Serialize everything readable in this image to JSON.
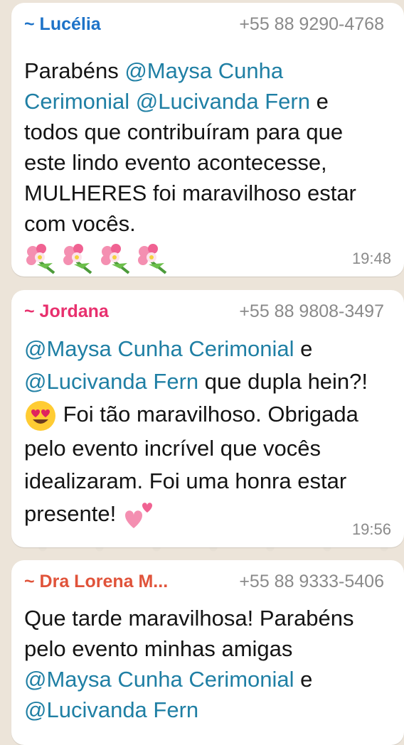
{
  "messages": [
    {
      "sender": "~ Lucélia",
      "sender_color": "#1e73c8",
      "phone": "+55 88 9290-4768",
      "time": "19:48",
      "text": {
        "p1": "Parabéns ",
        "mention1": "@Maysa Cunha Cerimonial",
        "p2": " ",
        "mention2": "@Lucivanda Fern",
        "p3": " e todos que contribuíram para que este lindo evento acontecesse, MULHERES foi maravilhoso estar com vocês."
      },
      "emoji": [
        "bouquet-icon",
        "bouquet-icon",
        "bouquet-icon",
        "bouquet-icon"
      ]
    },
    {
      "sender": "~ Jordana",
      "sender_color": "#e8306e",
      "phone": "+55 88 9808-3497",
      "time": "19:56",
      "text": {
        "mention1": "@Maysa Cunha Cerimonial",
        "p1": " e ",
        "mention2": "@Lucivanda Fern",
        "p2": " que dupla hein?! ",
        "p3": " Foi tão maravilhoso. Obrigada pelo evento incrível que vocês idealizaram. Foi uma honra estar presente! "
      },
      "emoji": [
        "heart-eyes-icon",
        "two-hearts-icon"
      ]
    },
    {
      "sender": "~ Dra Lorena M...",
      "sender_color": "#e0533a",
      "phone": "+55 88 9333-5406",
      "text": {
        "p1": "Que tarde maravilhosa! Parabéns pelo evento minhas amigas ",
        "mention1": "@Maysa Cunha Cerimonial",
        "p2": " e ",
        "mention2": "@Lucivanda Fern"
      }
    }
  ],
  "colors": {
    "mention": "#1f7fa4",
    "background": "#ece4d9",
    "bubble": "#ffffff",
    "meta": "#8a8a8a"
  }
}
